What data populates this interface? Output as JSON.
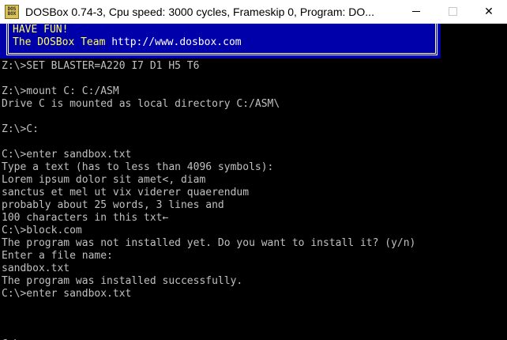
{
  "window": {
    "icon_text": "DOS\nBOX",
    "title": "DOSBox 0.74-3, Cpu speed:     3000 cycles, Frameskip  0, Program:    DO...",
    "controls": {
      "minimize": "—",
      "maximize": "□",
      "close": "✕"
    }
  },
  "banner": {
    "line1": "HAVE FUN!",
    "line2_prefix": "The DOSBox Team ",
    "line2_url": "http://www.dosbox.com"
  },
  "terminal": {
    "lines": [
      "Z:\\>SET BLASTER=A220 I7 D1 H5 T6",
      "",
      "Z:\\>mount C: C:/ASM",
      "Drive C is mounted as local directory C:/ASM\\",
      "",
      "Z:\\>C:",
      "",
      "C:\\>enter sandbox.txt",
      "Type a text (has to less than 4096 symbols):",
      "Lorem ipsum dolor sit amet<, diam",
      "sanctus et mel ut vix viderer quaerendum",
      "probably about 25 words, 3 lines and",
      "100 characters in this txt←",
      "C:\\>block.com",
      "The program was not installed yet. Do you want to install it? (y/n)",
      "Enter a file name:",
      "sandbox.txt",
      "The program was installed successfully.",
      "C:\\>enter sandbox.txt",
      "",
      "",
      ""
    ],
    "prompt": "C:\\>"
  },
  "colors": {
    "banner_bg": "#0000aa",
    "banner_text": "#ffff55",
    "console_bg": "#000000",
    "console_text": "#c0c0c0"
  }
}
